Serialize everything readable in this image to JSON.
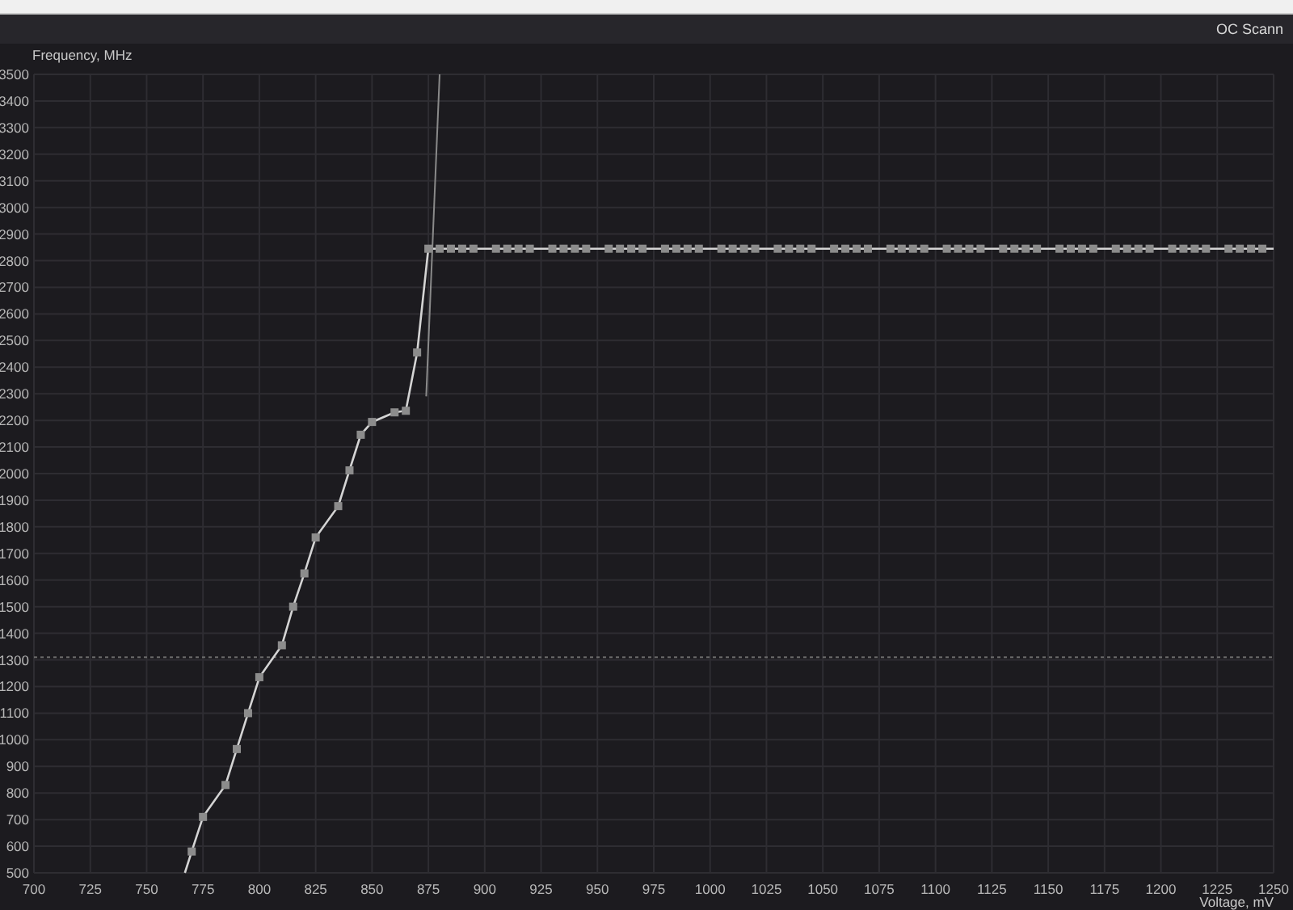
{
  "toolbar": {
    "button": "OC Scann"
  },
  "chart_data": {
    "type": "line",
    "xlabel": "Voltage, mV",
    "ylabel": "Frequency, MHz",
    "xlim": [
      700,
      1250
    ],
    "ylim": [
      500,
      3500
    ],
    "xticks": [
      700,
      725,
      750,
      775,
      800,
      825,
      850,
      875,
      900,
      925,
      950,
      975,
      1000,
      1025,
      1050,
      1075,
      1100,
      1125,
      1150,
      1175,
      1200,
      1225,
      1250
    ],
    "yticks": [
      500,
      600,
      700,
      800,
      900,
      1000,
      1100,
      1200,
      1300,
      1400,
      1500,
      1600,
      1700,
      1800,
      1900,
      2000,
      2100,
      2200,
      2300,
      2400,
      2500,
      2600,
      2700,
      2800,
      2900,
      3000,
      3100,
      3200,
      3300,
      3400,
      3500
    ],
    "series": [
      {
        "color": "#d4d4d4",
        "marker": "square",
        "x": [
          767,
          770,
          775,
          785,
          790,
          795,
          800,
          810,
          815,
          820,
          825,
          835,
          840,
          845,
          850,
          860,
          865,
          870,
          875,
          880,
          885,
          890,
          895,
          905,
          910,
          915,
          920,
          930,
          935,
          940,
          945,
          955,
          960,
          965,
          970,
          980,
          985,
          990,
          995,
          1005,
          1010,
          1015,
          1020,
          1030,
          1035,
          1040,
          1045,
          1055,
          1060,
          1065,
          1070,
          1080,
          1085,
          1090,
          1095,
          1105,
          1110,
          1115,
          1120,
          1130,
          1135,
          1140,
          1145,
          1155,
          1160,
          1165,
          1170,
          1180,
          1185,
          1190,
          1195,
          1205,
          1210,
          1215,
          1220,
          1230,
          1235,
          1240,
          1245,
          1250
        ],
        "values": [
          500,
          580,
          710,
          830,
          965,
          1100,
          1235,
          1355,
          1500,
          1625,
          1760,
          1878,
          2012,
          2146,
          2194,
          2230,
          2236,
          2455,
          2845,
          2845,
          2845,
          2845,
          2845,
          2845,
          2845,
          2845,
          2845,
          2845,
          2845,
          2845,
          2845,
          2845,
          2845,
          2845,
          2845,
          2845,
          2845,
          2845,
          2845,
          2845,
          2845,
          2845,
          2845,
          2845,
          2845,
          2845,
          2845,
          2845,
          2845,
          2845,
          2845,
          2845,
          2845,
          2845,
          2845,
          2845,
          2845,
          2845,
          2845,
          2845,
          2845,
          2845,
          2845,
          2845,
          2845,
          2845,
          2845,
          2845,
          2845,
          2845,
          2845,
          2845,
          2845,
          2845,
          2845,
          2845,
          2845,
          2845,
          2845,
          2845
        ]
      },
      {
        "color": "#8a8a8a",
        "x": [
          874,
          880
        ],
        "values": [
          2290,
          3500
        ]
      }
    ],
    "grid": true,
    "ref_lines": [
      {
        "axis": "y",
        "value": 1310
      }
    ]
  }
}
